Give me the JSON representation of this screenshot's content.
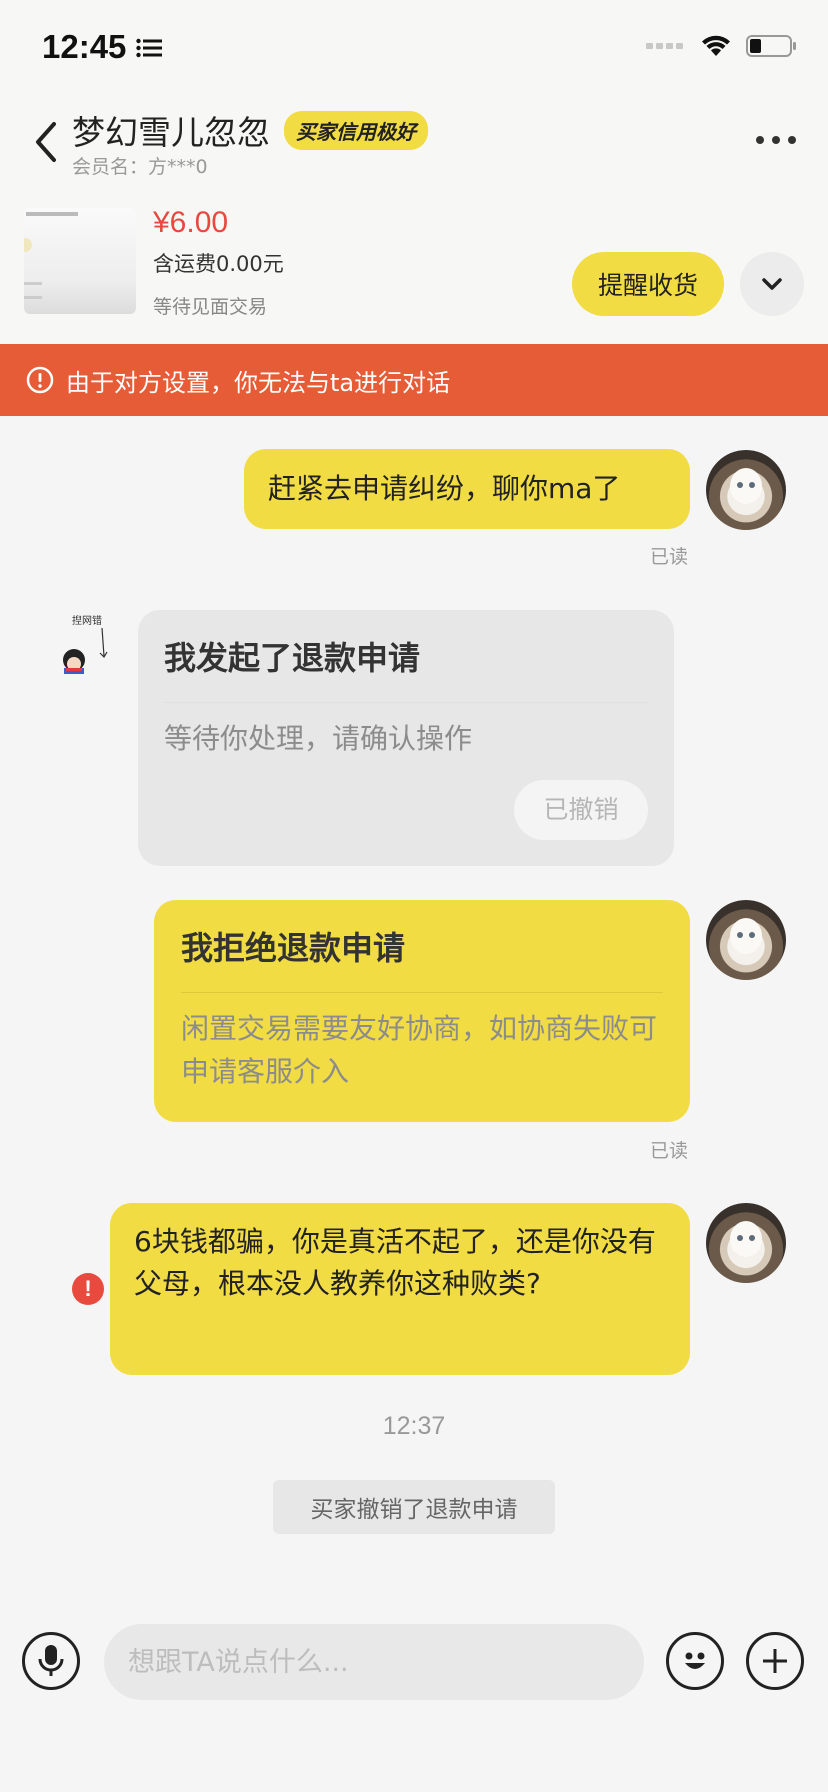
{
  "status_bar": {
    "time": "12:45"
  },
  "header": {
    "title": "梦幻雪儿忽忽",
    "credit_badge": "买家信用极好",
    "member": "会员名：方***0"
  },
  "product": {
    "price": "¥6.00",
    "shipping": "含运费0.00元",
    "trade_status": "等待见面交易",
    "remind_button": "提醒收货"
  },
  "alert": {
    "text": "由于对方设置，你无法与ta进行对话"
  },
  "messages": {
    "m1": {
      "text": "赶紧去申请纠纷，聊你ma了",
      "read": "已读"
    },
    "refund_request": {
      "title": "我发起了退款申请",
      "desc": "等待你处理，请确认操作",
      "button": "已撤销"
    },
    "refund_reject": {
      "title": "我拒绝退款申请",
      "desc": "闲置交易需要友好协商，如协商失败可申请客服介入",
      "read": "已读"
    },
    "m3": {
      "text": "6块钱都骗，你是真活不起了，还是你没有父母，根本没人教养你这种败类?"
    }
  },
  "timestamp": "12:37",
  "system_notice": "买家撤销了退款申请",
  "composer": {
    "placeholder": "想跟TA说点什么..."
  },
  "colors": {
    "accent": "#f2dc43",
    "alert": "#e65c36",
    "price": "#e8483e",
    "error": "#e84a3d"
  }
}
